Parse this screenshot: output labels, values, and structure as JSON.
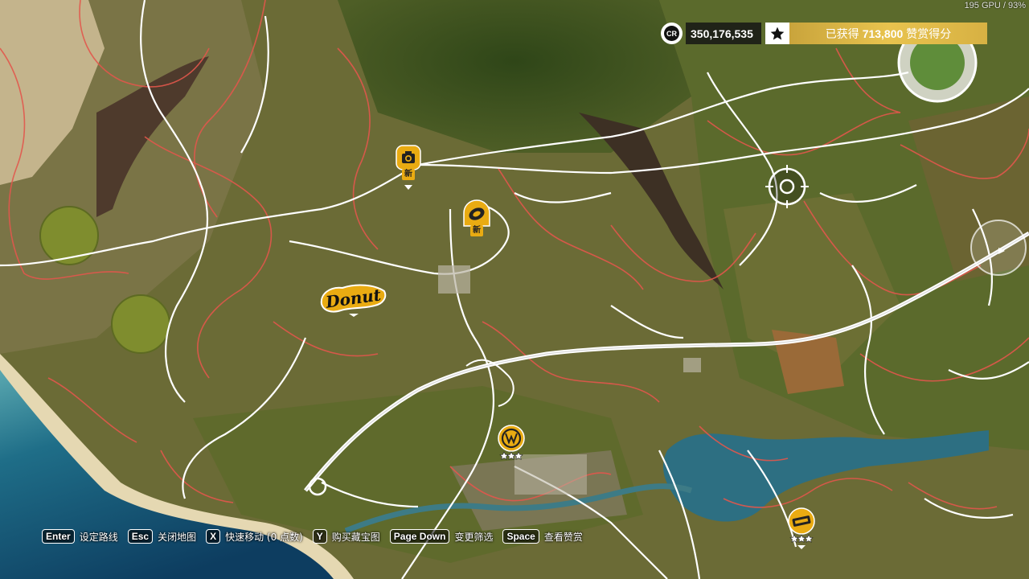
{
  "hud": {
    "perf": "195 GPU / 93%",
    "credits_icon": "CR",
    "credits": "350,176,535",
    "accolade_prefix": "已获得",
    "accolade_points": "713,800",
    "accolade_suffix": "赞赏得分"
  },
  "markers": {
    "photo": {
      "icon": "camera-icon",
      "badge": "新"
    },
    "drift": {
      "icon": "tire-drift-icon",
      "badge": "新"
    },
    "donut": {
      "label": "Donut"
    },
    "vw_dealer": {
      "icon": "vw-icon",
      "stars": 3
    },
    "xs_event": {
      "icon": "pxs-icon",
      "stars": 3
    }
  },
  "hints": [
    {
      "key": "Enter",
      "label": "设定路线"
    },
    {
      "key": "Esc",
      "label": "关闭地图"
    },
    {
      "key": "X",
      "label": "快速移动 (0 点数)"
    },
    {
      "key": "Y",
      "label": "购买藏宝图"
    },
    {
      "key": "Page Down",
      "label": "变更筛选"
    },
    {
      "key": "Space",
      "label": "查看赞赏"
    }
  ],
  "colors": {
    "marker_gold": "#e9ab12",
    "road_white": "#ffffff",
    "dirt_road": "#e2574c",
    "accolade_gold": "#d9b445",
    "water": "#2d6f82"
  }
}
